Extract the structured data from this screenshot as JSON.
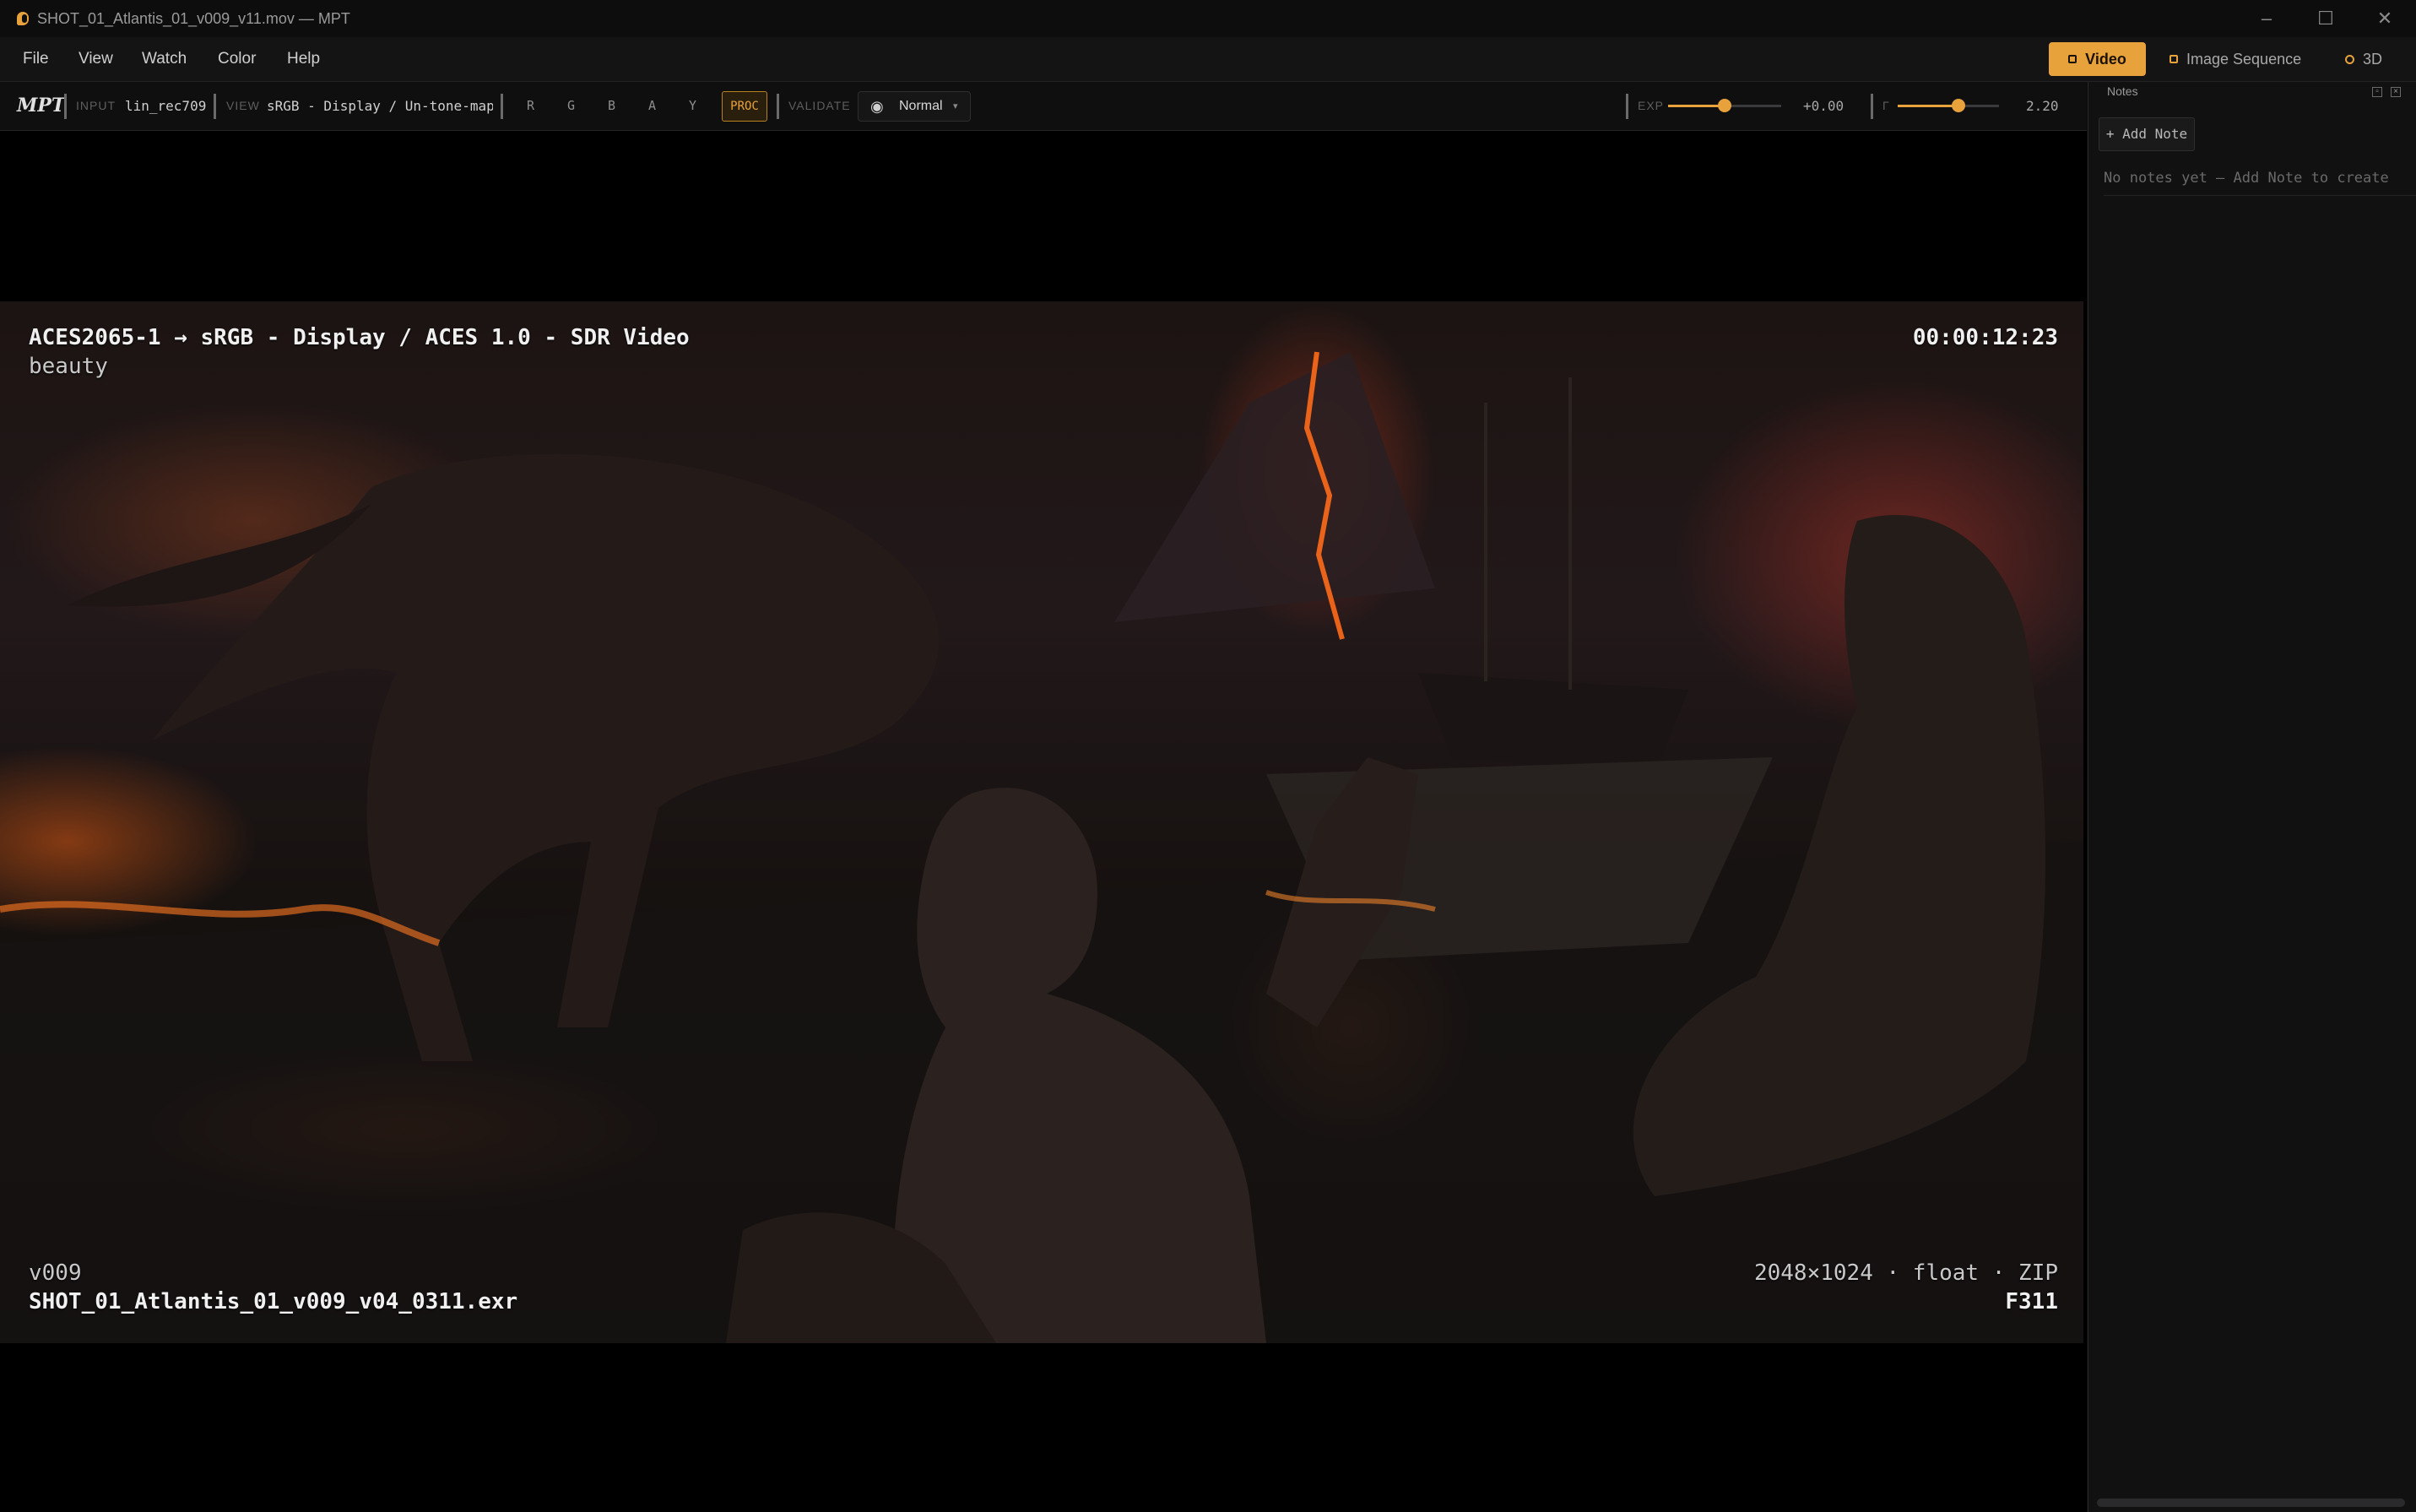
{
  "window": {
    "title": "SHOT_01_Atlantis_01_v009_v11.mov — MPT"
  },
  "menu": [
    "File",
    "View",
    "Watch",
    "Color",
    "Help"
  ],
  "modes": {
    "video": "Video",
    "image_sequence": "Image Sequence",
    "three_d": "3D"
  },
  "toolbar": {
    "logo": "MPT",
    "input_caption": "INPUT",
    "input_value": "lin_rec709",
    "view_caption": "VIEW",
    "view_value": "sRGB - Display / Un-tone-map…",
    "channels": [
      "R",
      "G",
      "B",
      "A",
      "Y"
    ],
    "proc_label": "PROC",
    "validate_caption": "VALIDATE",
    "validate_value": "Normal",
    "exposure_caption": "EXP",
    "exposure_value": "+0.00",
    "exposure_level": 0.5,
    "gamma_caption": "Γ",
    "gamma_value": "2.20",
    "gamma_level": 0.6
  },
  "viewer": {
    "colorspace": "ACES2065-1  →  sRGB - Display / ACES 1.0 - SDR Video",
    "layer": "beauty",
    "timecode": "00:00:12:23",
    "version": "v009",
    "filename": "SHOT_01_Atlantis_01_v009_v04_0311.exr",
    "format_info": "2048×1024  ·  float  ·  ZIP",
    "frame": "F311"
  },
  "notes": {
    "title": "Notes",
    "add_label": "+ Add Note",
    "empty_text": "No notes yet — Add Note to create"
  }
}
